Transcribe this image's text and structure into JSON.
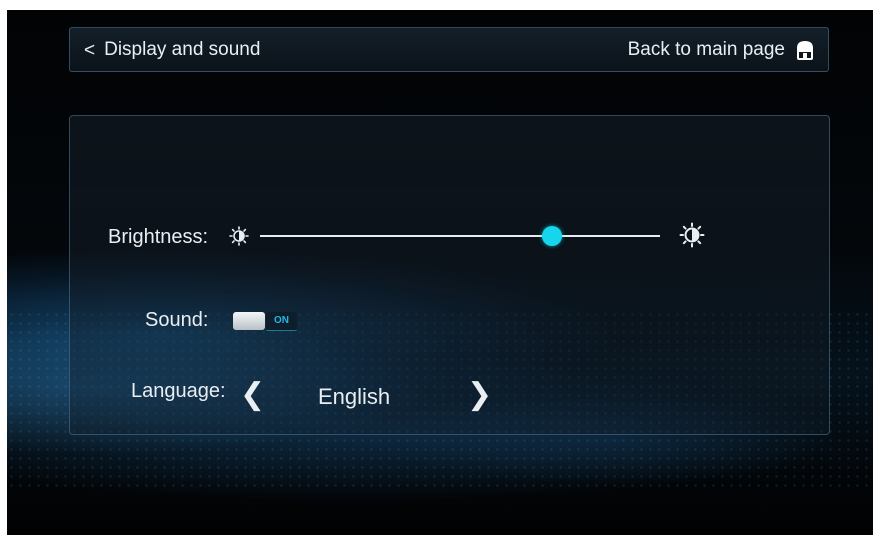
{
  "header": {
    "back_chevron": "<",
    "back_label": "Display and sound",
    "home_label": "Back to main page",
    "home_icon": "home-icon"
  },
  "settings": {
    "brightness": {
      "label": "Brightness:",
      "icon_low": "sun-small-icon",
      "icon_high": "sun-large-icon",
      "value_fraction": 0.73
    },
    "sound": {
      "label": "Sound:",
      "state": "ON"
    },
    "language": {
      "label": "Language:",
      "prev_glyph": "❮",
      "value": "English",
      "next_glyph": "❯"
    }
  },
  "colors": {
    "accent": "#16d6ee",
    "text": "#e9eef2",
    "toggle_on_text": "#1fb8e6"
  }
}
